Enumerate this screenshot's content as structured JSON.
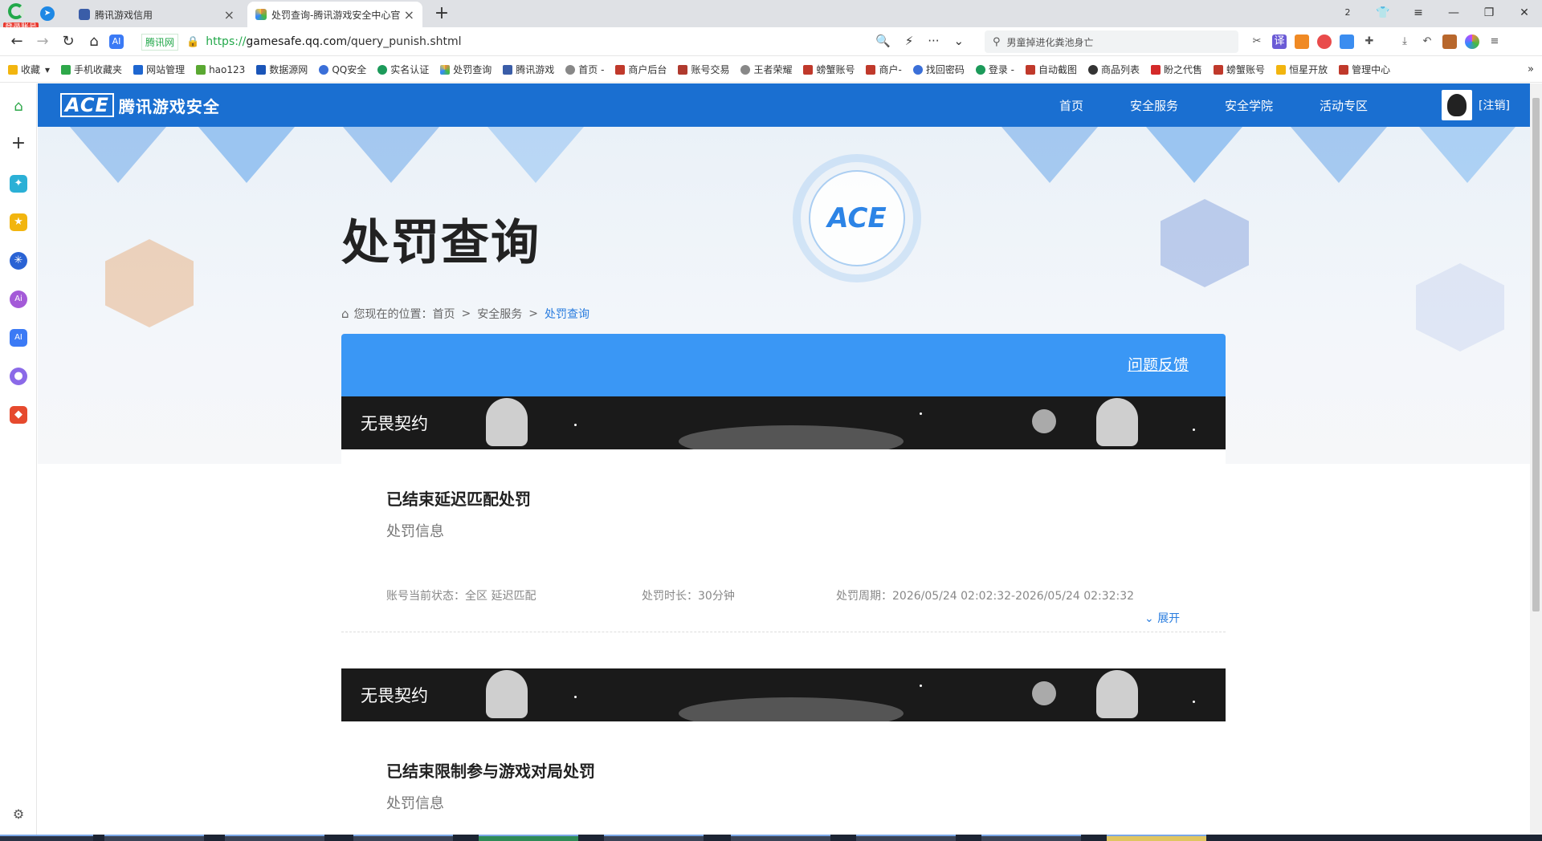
{
  "browser": {
    "badge": "登录账号",
    "tabs": [
      {
        "title": "腾讯游戏信用",
        "active": false
      },
      {
        "title": "处罚查询-腾讯游戏安全中心官",
        "active": true
      }
    ],
    "url_prefix": "https://",
    "url_host": "gamesafe.qq.com",
    "url_path": "/query_punish.shtml",
    "site_badge": "腾讯网",
    "search_text": "男童掉进化粪池身亡",
    "tab_count": "2"
  },
  "bookmarks": [
    "收藏",
    "手机收藏夹",
    "网站管理",
    "hao123",
    "数据源网",
    "QQ安全",
    "实名认证",
    "处罚查询",
    "腾讯游戏",
    "首页 -",
    "商户后台",
    "账号交易",
    "王者荣耀",
    "螃蟹账号",
    "商户-",
    "找回密码",
    "登录 -",
    "自动截图",
    "商品列表",
    "盼之代售",
    "螃蟹账号",
    "恒星开放",
    "管理中心"
  ],
  "site": {
    "logo_mark": "ACE",
    "logo_name": "腾讯游戏安全",
    "nav": [
      "首页",
      "安全服务",
      "安全学院",
      "活动专区"
    ],
    "logout": "[注销]"
  },
  "page": {
    "title": "处罚查询",
    "breadcrumb_prefix": "您现在的位置：",
    "breadcrumb": [
      "首页",
      "安全服务",
      "处罚查询"
    ],
    "feedback": "问题反馈"
  },
  "records": [
    {
      "game": "无畏契约",
      "title": "已结束延迟匹配处罚",
      "section": "处罚信息",
      "status_label": "账号当前状态：",
      "status": "全区 延迟匹配",
      "duration_label": "处罚时长：",
      "duration": "30分钟",
      "period_label": "处罚周期：",
      "period": "2026/05/24 02:02:32-2026/05/24 02:32:32",
      "expand": "展开"
    },
    {
      "game": "无畏契约",
      "title": "已结束限制参与游戏对局处罚",
      "section": "处罚信息"
    }
  ]
}
